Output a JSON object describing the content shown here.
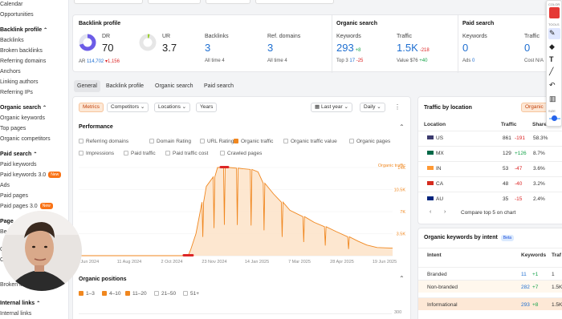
{
  "sidebar": {
    "items": [
      {
        "label": "Calendar",
        "type": "item"
      },
      {
        "label": "Opportunities",
        "type": "item"
      },
      {
        "label": "Backlink profile",
        "type": "head"
      },
      {
        "label": "Backlinks",
        "type": "item"
      },
      {
        "label": "Broken backlinks",
        "type": "item"
      },
      {
        "label": "Referring domains",
        "type": "item"
      },
      {
        "label": "Anchors",
        "type": "item"
      },
      {
        "label": "Linking authors",
        "type": "item"
      },
      {
        "label": "Referring IPs",
        "type": "item"
      },
      {
        "label": "Organic search",
        "type": "head"
      },
      {
        "label": "Organic keywords",
        "type": "item"
      },
      {
        "label": "Top pages",
        "type": "item"
      },
      {
        "label": "Organic competitors",
        "type": "item"
      },
      {
        "label": "Paid search",
        "type": "head"
      },
      {
        "label": "Paid keywords",
        "type": "item"
      },
      {
        "label": "Paid keywords 3.0",
        "type": "item",
        "badge": "New"
      },
      {
        "label": "Ads",
        "type": "item"
      },
      {
        "label": "Paid pages",
        "type": "item"
      },
      {
        "label": "Paid pages 3.0",
        "type": "item",
        "badge": "New"
      },
      {
        "label": "Page",
        "type": "head-partial"
      },
      {
        "label": "Be",
        "type": "item"
      },
      {
        "label": "Outg",
        "type": "item"
      },
      {
        "label": "Outgo",
        "type": "item"
      },
      {
        "label": "Broken links",
        "type": "item"
      },
      {
        "label": "Internal links",
        "type": "head"
      },
      {
        "label": "Internal links",
        "type": "item"
      }
    ]
  },
  "backlink_profile": {
    "title": "Backlink profile",
    "dr_label": "DR",
    "dr_value": "70",
    "ar_label": "AR",
    "ar_value": "114,702",
    "ar_change": "▾1,156",
    "ur_label": "UR",
    "ur_value": "3.7",
    "backlinks_label": "Backlinks",
    "backlinks_value": "3",
    "backlinks_sub": "All time",
    "backlinks_sub_value": "4",
    "refdomains_label": "Ref. domains",
    "refdomains_value": "3",
    "refdomains_sub": "All time",
    "refdomains_sub_value": "4"
  },
  "organic_search": {
    "title": "Organic search",
    "keywords_label": "Keywords",
    "keywords_value": "293",
    "keywords_change": "+8",
    "top3_label": "Top 3",
    "top3_value": "17",
    "top3_change": "-25",
    "traffic_label": "Traffic",
    "traffic_value": "1.5K",
    "traffic_change": "-218",
    "value_label": "Value",
    "value_value": "$76",
    "value_change": "+40"
  },
  "paid_search": {
    "title": "Paid search",
    "keywords_label": "Keywords",
    "keywords_value": "0",
    "ads_label": "Ads",
    "ads_value": "0",
    "traffic_label": "Traffic",
    "traffic_value": "0",
    "cost_label": "Cost N/A"
  },
  "tabs": [
    "General",
    "Backlink profile",
    "Organic search",
    "Paid search"
  ],
  "controls": {
    "metrics": "Metrics",
    "competitors": "Competitors",
    "locations": "Locations",
    "years": "Years",
    "last_year": "Last year",
    "daily": "Daily"
  },
  "performance": {
    "title": "Performance",
    "checks": [
      {
        "label": "Referring domains",
        "on": false
      },
      {
        "label": "Domain Rating",
        "on": false
      },
      {
        "label": "URL Rating",
        "on": false
      },
      {
        "label": "Organic traffic",
        "on": true
      },
      {
        "label": "Organic traffic value",
        "on": false
      },
      {
        "label": "Organic pages",
        "on": false
      },
      {
        "label": "Impressions",
        "on": false
      },
      {
        "label": "Paid traffic",
        "on": false
      },
      {
        "label": "Paid traffic cost",
        "on": false
      },
      {
        "label": "Crawled pages",
        "on": false
      }
    ]
  },
  "chart_data": {
    "type": "area",
    "series_label": "Organic traffic",
    "color": "#f0871f",
    "y_ticks": [
      "14K",
      "10.5K",
      "7K",
      "3.5K"
    ],
    "x_ticks": [
      "20 Jun 2024",
      "11 Aug 2024",
      "2 Oct 2024",
      "23 Nov 2024",
      "14 Jan 2025",
      "7 Mar 2025",
      "28 Apr 2025",
      "19 Jun 2025"
    ],
    "ylim": [
      0,
      14000
    ],
    "x": [
      "2024-06-20",
      "2024-08-11",
      "2024-10-02",
      "2024-10-25",
      "2024-10-28",
      "2024-11-03",
      "2024-11-10",
      "2024-11-15",
      "2024-11-23",
      "2024-11-28",
      "2024-12-05",
      "2024-12-12",
      "2024-12-20",
      "2024-12-28",
      "2025-01-05",
      "2025-01-14",
      "2025-01-20",
      "2025-02-01",
      "2025-02-10",
      "2025-02-20",
      "2025-03-07",
      "2025-03-20",
      "2025-04-01",
      "2025-04-15",
      "2025-04-28",
      "2025-05-10",
      "2025-05-20",
      "2025-06-01",
      "2025-06-19"
    ],
    "y": [
      0,
      0,
      0,
      0,
      1000,
      3500,
      8500,
      11000,
      12500,
      14000,
      14000,
      14000,
      13900,
      13800,
      13700,
      13300,
      11500,
      9800,
      8500,
      7200,
      6200,
      5300,
      4600,
      3800,
      3000,
      2300,
      1700,
      1300,
      1200
    ]
  },
  "organic_positions": {
    "title": "Organic positions",
    "checks": [
      {
        "label": "1–3",
        "on": true
      },
      {
        "label": "4–10",
        "on": true
      },
      {
        "label": "11–20",
        "on": true
      },
      {
        "label": "21–50",
        "on": false
      },
      {
        "label": "51+",
        "on": false
      }
    ],
    "y_tick": "300"
  },
  "traffic_by_location": {
    "title": "Traffic by location",
    "headers": [
      "Location",
      "Traffic",
      "Share"
    ],
    "rows": [
      {
        "code": "US",
        "traffic": "861",
        "change": "-191",
        "share": "58.3%",
        "flag": "#3c3b6e"
      },
      {
        "code": "MX",
        "traffic": "129",
        "change": "+126",
        "share": "8.7%",
        "flag": "#006847"
      },
      {
        "code": "IN",
        "traffic": "53",
        "change": "-47",
        "share": "3.6%",
        "flag": "#ff9933"
      },
      {
        "code": "CA",
        "traffic": "48",
        "change": "-40",
        "share": "3.2%",
        "flag": "#d52b1e"
      },
      {
        "code": "AU",
        "traffic": "35",
        "change": "-15",
        "share": "2.4%",
        "flag": "#00247d"
      }
    ],
    "compare_label": "Compare top 5 on chart"
  },
  "keywords_by_intent": {
    "title": "Organic keywords by intent",
    "badge": "Beta",
    "headers": [
      "Intent",
      "Keywords",
      "Traf"
    ],
    "rows": [
      {
        "intent": "Branded",
        "kw": "11",
        "change": "+1",
        "traffic": "1"
      },
      {
        "intent": "Non-branded",
        "kw": "282",
        "change": "+7",
        "traffic": "1.5K"
      },
      {
        "intent": "Informational",
        "kw": "293",
        "change": "+8",
        "traffic": "1.5K"
      }
    ]
  },
  "palette": {
    "color_label": "COLOR",
    "tools_label": "TOOLS",
    "size_label": "SIZE",
    "color": "#e53935"
  }
}
